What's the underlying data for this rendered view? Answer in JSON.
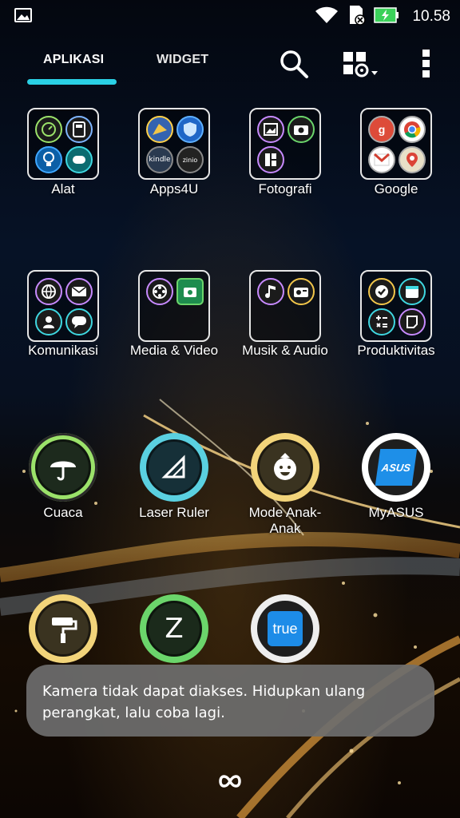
{
  "status_bar": {
    "time": "10.58",
    "icons": [
      "image-notification-icon",
      "wifi-icon",
      "sd-card-icon",
      "battery-charging-icon"
    ]
  },
  "tabs": {
    "apps_label": "APLIKASI",
    "widget_label": "WIDGET",
    "active_tab": "APLIKASI",
    "accent_color": "#2ad0e4"
  },
  "toolbar": {
    "icons": [
      "search-icon",
      "settings-grid-icon",
      "more-vert-icon"
    ]
  },
  "folders": [
    {
      "label": "Alat",
      "icons": [
        "speedometer-icon",
        "calculator-icon",
        "lightbulb-icon",
        "cleaner-icon"
      ]
    },
    {
      "label": "Apps4U",
      "icons": [
        "boost-icon",
        "shield-icon",
        "kindle-icon",
        "zinio-icon"
      ]
    },
    {
      "label": "Fotografi",
      "icons": [
        "gallery-icon",
        "camera-icon",
        "photo-collage-icon"
      ]
    },
    {
      "label": "Google",
      "icons": [
        "google-plus-icon",
        "chrome-icon",
        "gmail-icon",
        "maps-icon"
      ]
    },
    {
      "label": "Komunikasi",
      "icons": [
        "browser-icon",
        "email-icon",
        "contacts-icon",
        "messages-icon"
      ]
    },
    {
      "label": "Media & Video",
      "icons": [
        "film-reel-icon",
        "camera-video-icon"
      ]
    },
    {
      "label": "Musik & Audio",
      "icons": [
        "music-note-icon",
        "radio-icon"
      ]
    },
    {
      "label": "Produktivitas",
      "icons": [
        "do-it-later-icon",
        "calendar-icon",
        "calculator-icon",
        "notes-icon"
      ]
    }
  ],
  "apps": [
    {
      "label": "Cuaca",
      "icon": "umbrella-icon"
    },
    {
      "label": "Laser Ruler",
      "icon": "ruler-icon"
    },
    {
      "label": "Mode Anak-Anak",
      "label_line1": "Mode Anak-",
      "label_line2": "Anak",
      "icon": "kid-face-icon"
    },
    {
      "label": "MyASUS",
      "icon": "asus-logo-icon",
      "logo_text": "ASUS"
    },
    {
      "label": "",
      "icon": "paint-roller-icon"
    },
    {
      "label": "",
      "icon": "zenui-z-icon",
      "glyph": "Z"
    },
    {
      "label": "",
      "icon": "truecaller-icon",
      "logo_text": "true"
    }
  ],
  "toast": {
    "message": "Kamera tidak dapat diakses. Hidupkan ulang perangkat, lalu coba lagi."
  },
  "bottom": {
    "icon": "infinity-icon"
  }
}
